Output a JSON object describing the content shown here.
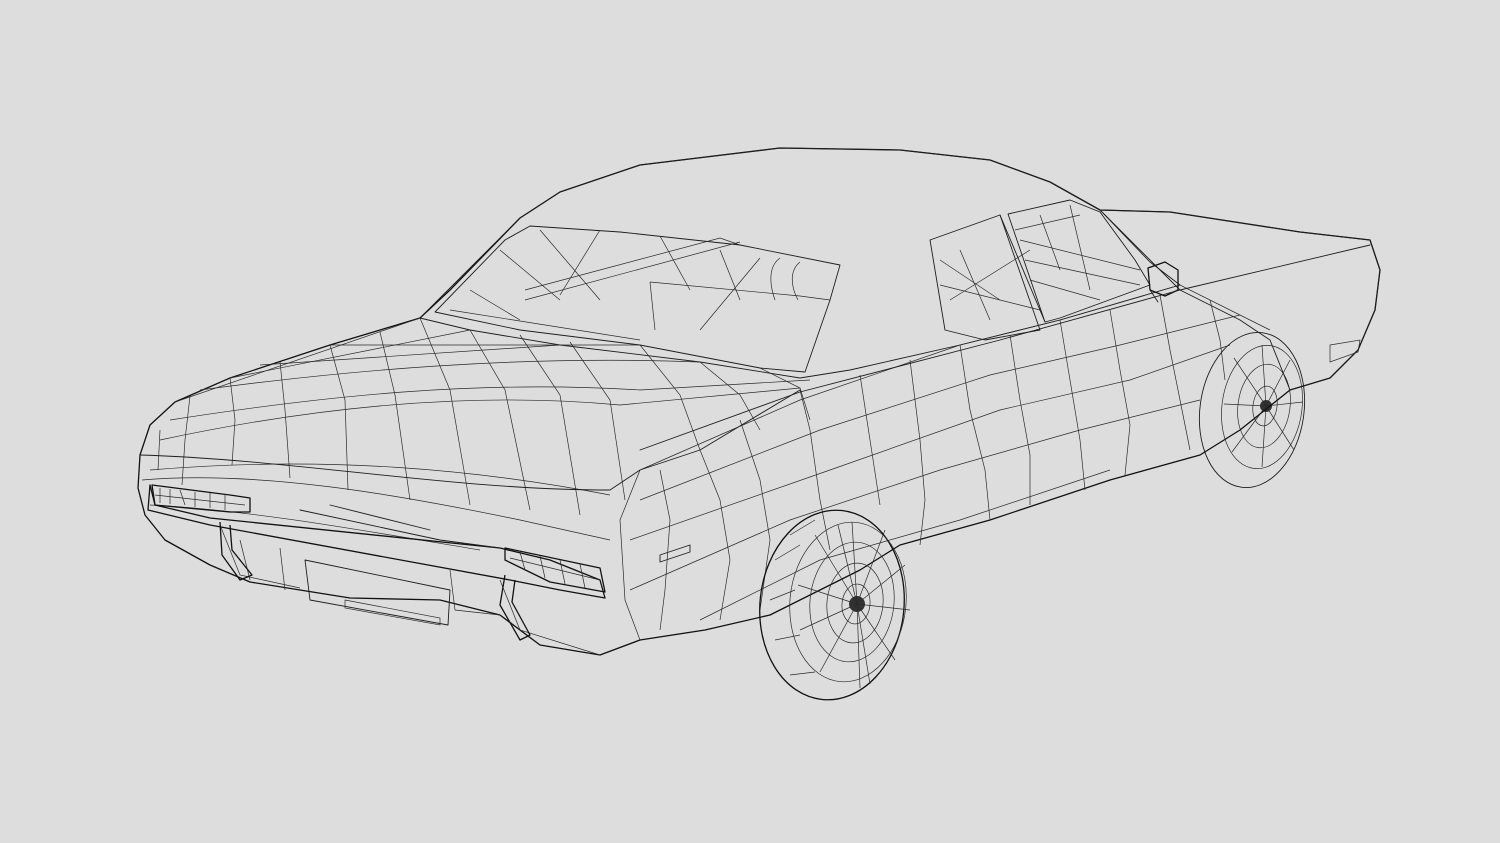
{
  "scene": {
    "subject": "car-3d-wireframe-model",
    "view": "rear-three-quarter",
    "colors": {
      "background": "#dddddd",
      "body_fill": "#dde3e3",
      "glass_fill": "#ffffff",
      "wire_stroke": "#1e1e1e",
      "hub_fill": "#333333"
    }
  }
}
